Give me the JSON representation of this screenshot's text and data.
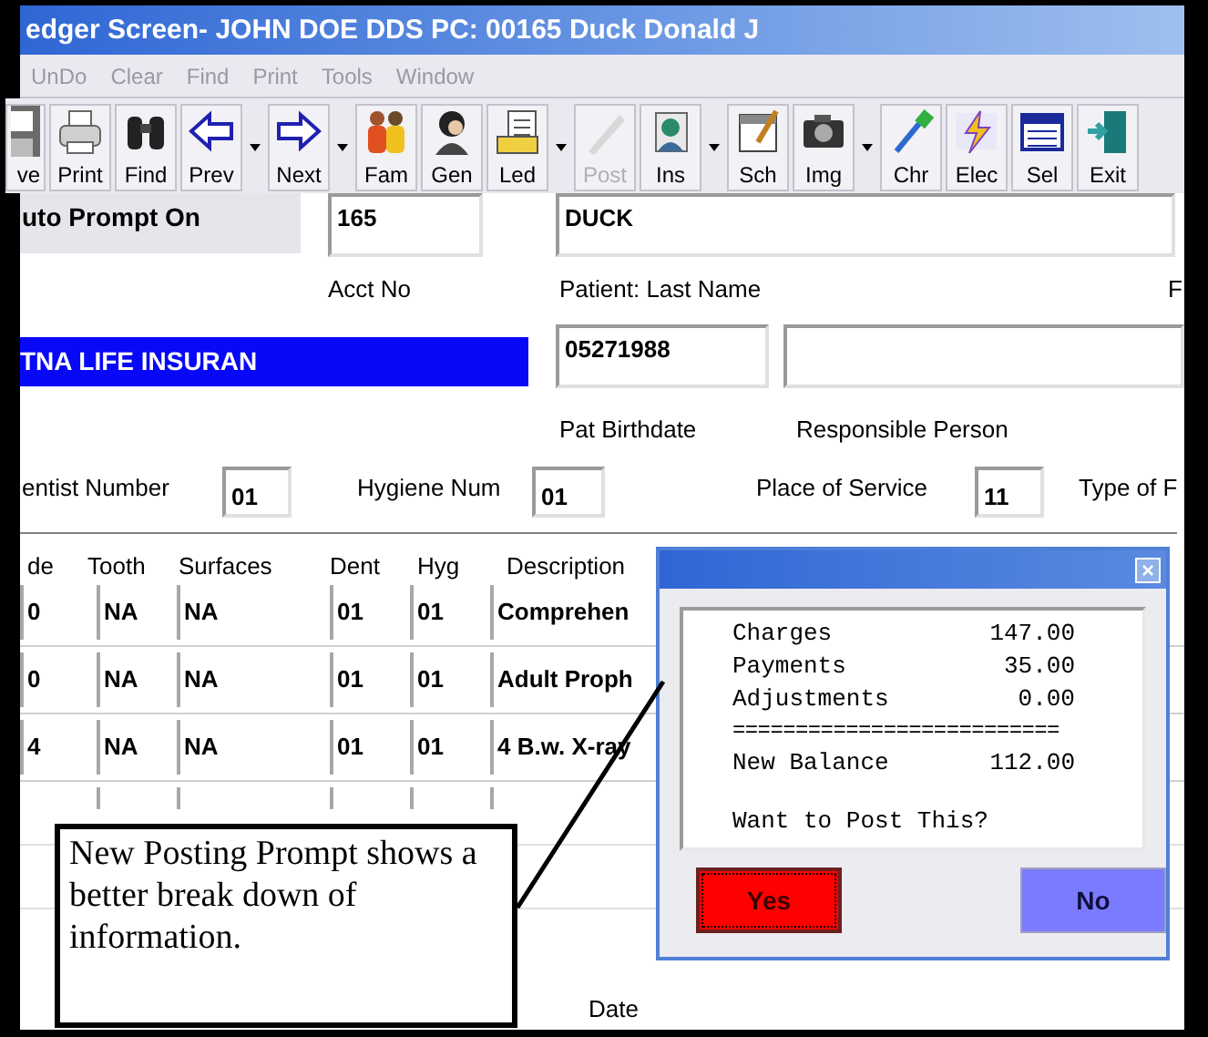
{
  "window": {
    "title": "edger Screen- JOHN DOE  DDS PC: 00165 Duck Donald J"
  },
  "menu": [
    {
      "label": "UnDo",
      "disabled": true
    },
    {
      "label": "Clear",
      "disabled": true
    },
    {
      "label": "Find",
      "disabled": true
    },
    {
      "label": "Print",
      "disabled": true
    },
    {
      "label": "Tools",
      "disabled": true
    },
    {
      "label": "Window",
      "disabled": true
    }
  ],
  "toolbar": [
    {
      "kind": "button",
      "label": "ve",
      "disabled": false
    },
    {
      "kind": "button",
      "label": "Print",
      "disabled": false
    },
    {
      "kind": "button",
      "label": "Find",
      "disabled": false
    },
    {
      "kind": "button",
      "label": "Prev",
      "disabled": false
    },
    {
      "kind": "dropdown"
    },
    {
      "kind": "button",
      "label": "Next",
      "disabled": false
    },
    {
      "kind": "dropdown"
    },
    {
      "kind": "button",
      "label": "Fam",
      "disabled": false
    },
    {
      "kind": "button",
      "label": "Gen",
      "disabled": false
    },
    {
      "kind": "button",
      "label": "Led",
      "disabled": false
    },
    {
      "kind": "dropdown"
    },
    {
      "kind": "button",
      "label": "Post",
      "disabled": true
    },
    {
      "kind": "button",
      "label": "Ins",
      "disabled": false
    },
    {
      "kind": "dropdown"
    },
    {
      "kind": "button",
      "label": "Sch",
      "disabled": false
    },
    {
      "kind": "button",
      "label": "Img",
      "disabled": false
    },
    {
      "kind": "dropdown"
    },
    {
      "kind": "button",
      "label": "Chr",
      "disabled": false
    },
    {
      "kind": "button",
      "label": "Elec",
      "disabled": false
    },
    {
      "kind": "button",
      "label": "Sel",
      "disabled": false
    },
    {
      "kind": "button",
      "label": "Exit",
      "disabled": false
    }
  ],
  "form": {
    "auto_prompt": "uto Prompt On",
    "acct_no": {
      "label": "Acct No",
      "value": "165"
    },
    "last_name": {
      "label": "Patient: Last Name",
      "value": "DUCK"
    },
    "column_3_label": "F",
    "insurance": "TNA LIFE INSURAN",
    "birthdate": {
      "label": "Pat Birthdate",
      "value": "05271988"
    },
    "responsible_person": {
      "label": "Responsible Person"
    },
    "dentist_number": {
      "label": "entist Number",
      "value": "01"
    },
    "hygiene_num": {
      "label": "Hygiene Num",
      "value": "01"
    },
    "place_of_service": {
      "label": "Place of Service",
      "value": "11"
    },
    "type_label": "Type of F"
  },
  "table": {
    "columns": [
      "de",
      "Tooth",
      "Surfaces",
      "Dent",
      "Hyg",
      "Description"
    ],
    "rows": [
      [
        "0",
        "NA",
        "NA",
        "01",
        "01",
        "Comprehen"
      ],
      [
        "0",
        "NA",
        "NA",
        "01",
        "01",
        "Adult Proph"
      ],
      [
        "4",
        "NA",
        "NA",
        "01",
        "01",
        "4 B.w. X-ray"
      ]
    ]
  },
  "date_label": "Date",
  "dialog": {
    "close": "×",
    "lines": [
      {
        "label": "Charges",
        "value": "147.00"
      },
      {
        "label": "Payments",
        "value": "35.00"
      },
      {
        "label": "Adjustments",
        "value": "0.00"
      }
    ],
    "separator": "==========================",
    "total": {
      "label": "New Balance",
      "value": "112.00"
    },
    "question": "Want to Post This?",
    "buttons": [
      {
        "label": "Yes",
        "kind": "yes"
      },
      {
        "label": "No",
        "kind": "no"
      }
    ]
  },
  "callout": {
    "text": "New Posting Prompt shows a better break down of information."
  }
}
